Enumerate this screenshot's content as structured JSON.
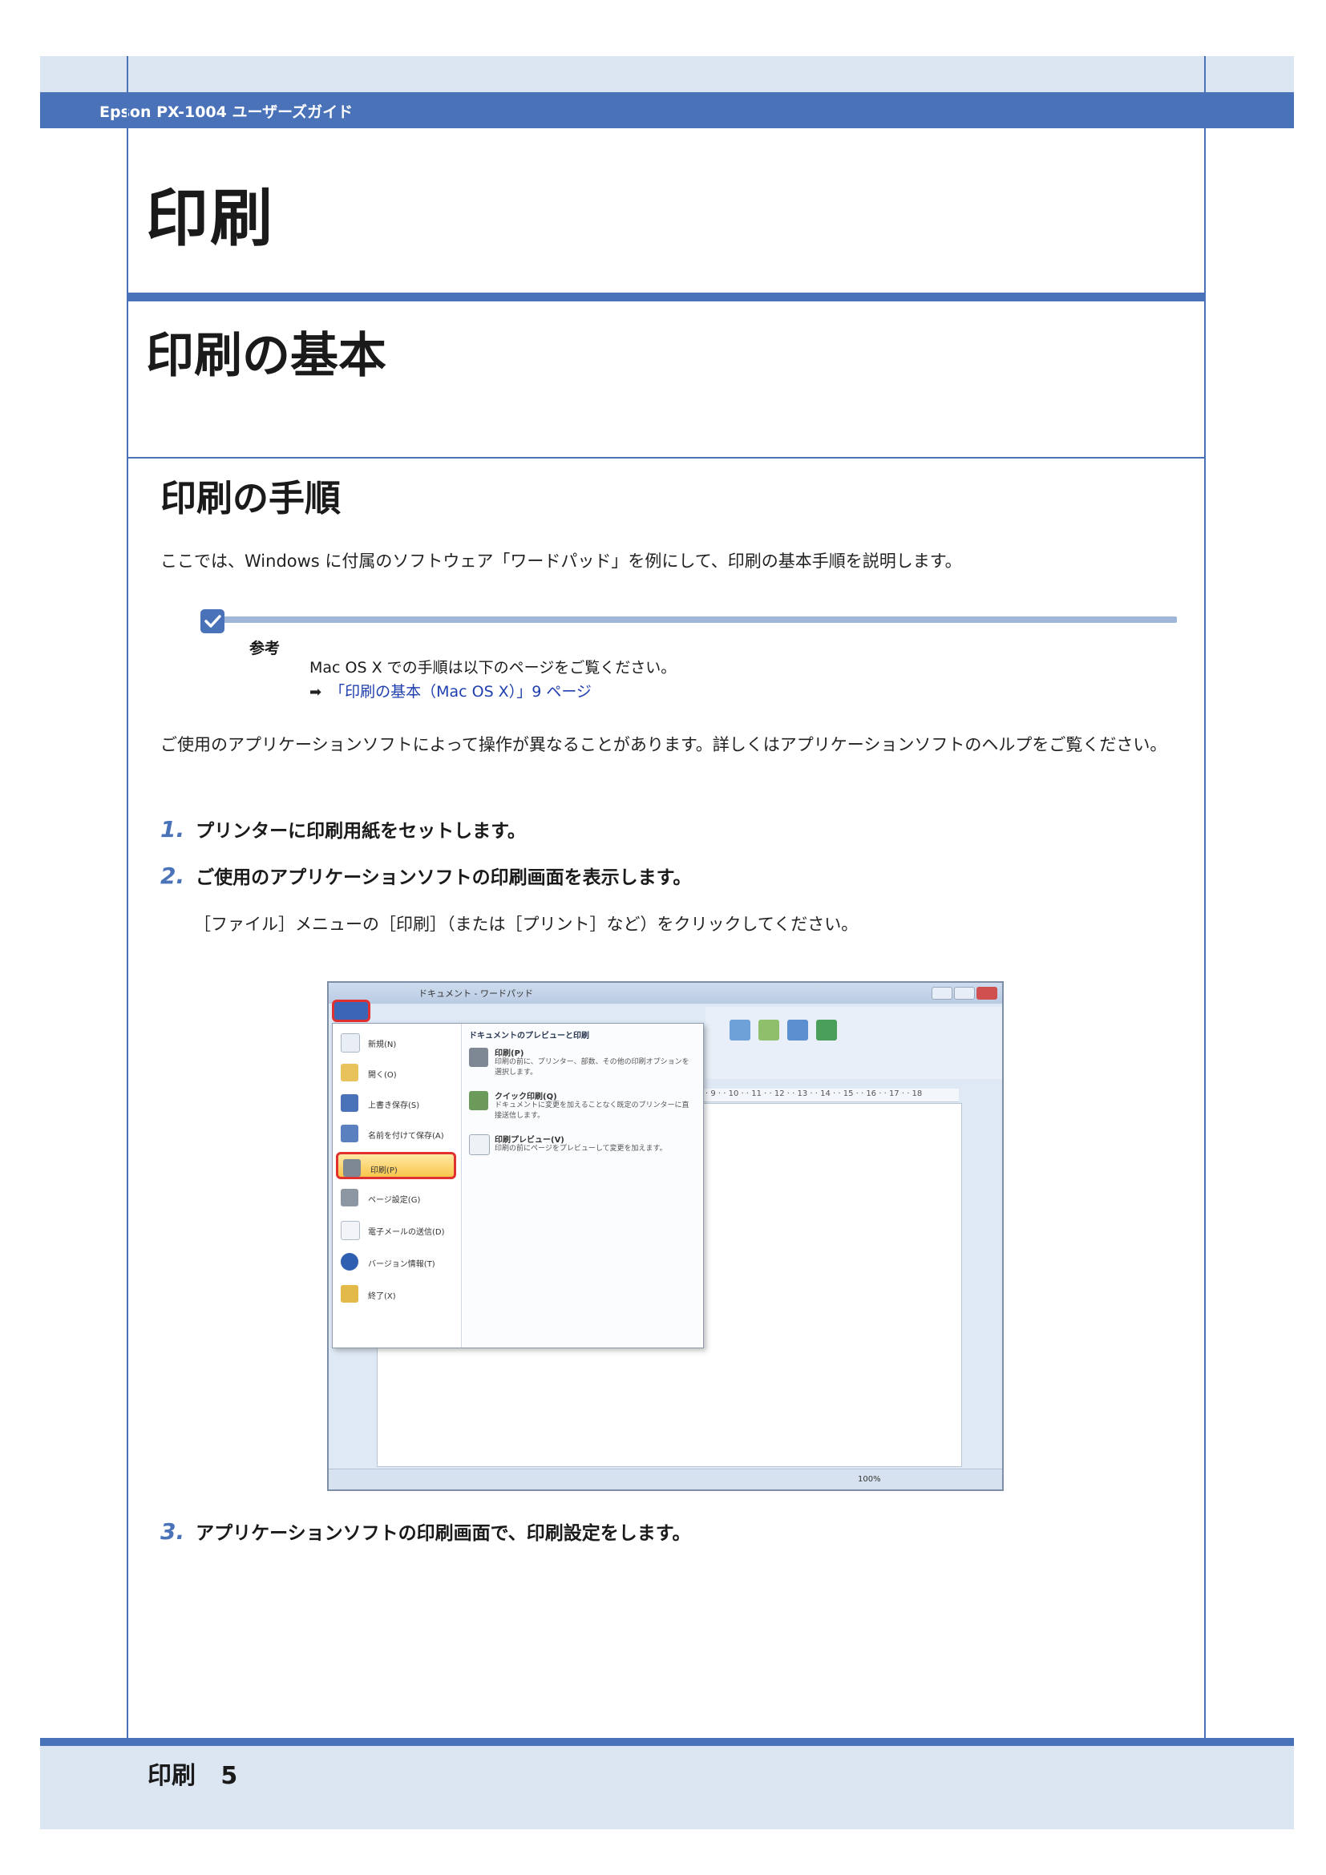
{
  "header": {
    "guide_title": "Epson PX-1004 ユーザーズガイド"
  },
  "chapter_title": "印刷",
  "section_title": "印刷の基本",
  "subsection_title": "印刷の手順",
  "intro": "ここでは、Windows に付属のソフトウェア「ワードパッド」を例にして、印刷の基本手順を説明します。",
  "note": {
    "label": "参考",
    "body": "Mac OS X での手順は以下のページをご覧ください。",
    "link_text": "「印刷の基本（Mac OS X）」9 ページ"
  },
  "paragraph2": "ご使用のアプリケーションソフトによって操作が異なることがあります。詳しくはアプリケーションソフトのヘルプをご覧ください。",
  "steps": [
    {
      "num": "1.",
      "text": "プリンターに印刷用紙をセットします。"
    },
    {
      "num": "2.",
      "text": "ご使用のアプリケーションソフトの印刷画面を表示します。",
      "desc": "［ファイル］メニューの［印刷］（または［プリント］など）をクリックしてください。"
    },
    {
      "num": "3.",
      "text": "アプリケーションソフトの印刷画面で、印刷設定をします。"
    }
  ],
  "screenshot": {
    "window_title": "ドキュメント - ワードパッド",
    "menu_items": [
      "新規(N)",
      "開く(O)",
      "上書き保存(S)",
      "名前を付けて保存(A)",
      "印刷(P)",
      "ページ設定(G)",
      "電子メールの送信(D)",
      "バージョン情報(T)",
      "終了(X)"
    ],
    "submenu_header": "ドキュメントのプレビューと印刷",
    "submenu": [
      {
        "title": "印刷(P)",
        "desc": "印刷の前に、プリンター、部数、その他の印刷オプションを選択します。"
      },
      {
        "title": "クイック印刷(Q)",
        "desc": "ドキュメントに変更を加えることなく既定のプリンターに直接送信します。"
      },
      {
        "title": "印刷プレビュー(V)",
        "desc": "印刷の前にページをプレビューして変更を加えます。"
      }
    ],
    "ruler": "· 9 · · 10 · · 11 · · 12 · · 13 · · 14 · · 15 · · 16 · · 17 · · 18",
    "zoom": "100%"
  },
  "footer": {
    "chapter": "印刷",
    "page": "5"
  }
}
